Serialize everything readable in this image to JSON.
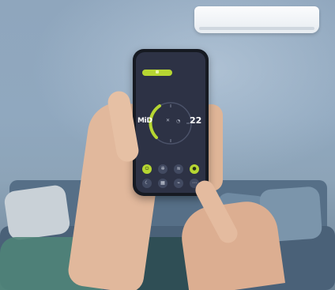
{
  "scene": {
    "colors": {
      "screen_bg": "#2d3245",
      "accent": "#b6d632",
      "wall": "#90a8bf"
    }
  },
  "app": {
    "mode_label": "MiD",
    "temperature": "22",
    "icons": {
      "mode_icon": "fan-icon",
      "timer_icon": "timer-icon",
      "btn_1": "power-icon",
      "btn_2": "settings-icon",
      "btn_3": "swing-icon",
      "btn_4": "mode-icon",
      "btn_5": "sleep-icon",
      "btn_6": "calendar-icon",
      "btn_7": "eco-icon",
      "btn_8": "more-icon"
    },
    "glyphs": {
      "fan": "✕",
      "timer": "◔",
      "btn_1": "⏻",
      "btn_2": "✲",
      "btn_3": "≋",
      "btn_4": "●",
      "btn_5": "☾",
      "btn_6": "▦",
      "btn_7": "⌁",
      "btn_8": "⋯"
    }
  }
}
